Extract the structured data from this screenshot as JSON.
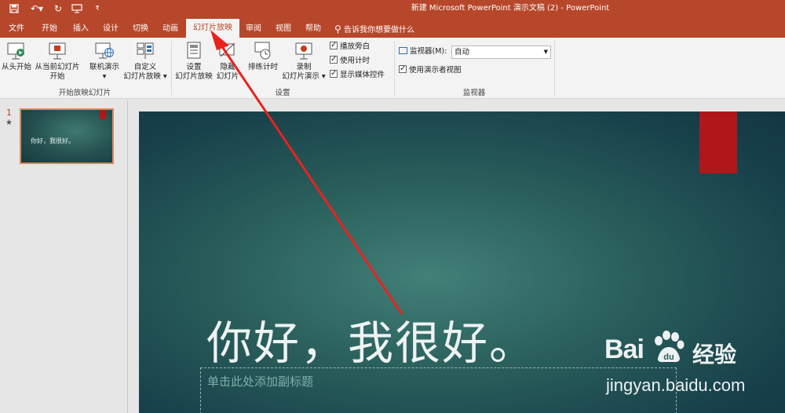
{
  "titlebar": {
    "title": "新建 Microsoft PowerPoint 演示文稿 (2)  -  PowerPoint",
    "qa_icons": [
      "save-icon",
      "undo-icon",
      "redo-icon",
      "present-icon",
      "customize-icon"
    ]
  },
  "tabs": [
    {
      "label": "文件"
    },
    {
      "label": "开始"
    },
    {
      "label": "插入"
    },
    {
      "label": "设计"
    },
    {
      "label": "切换"
    },
    {
      "label": "动画"
    },
    {
      "label": "幻灯片放映",
      "active": true
    },
    {
      "label": "审阅"
    },
    {
      "label": "视图"
    },
    {
      "label": "帮助"
    }
  ],
  "tell_me": "告诉我你想要做什么",
  "ribbon": {
    "start_group": {
      "label": "开始放映幻灯片",
      "from_start": "从头开始",
      "from_current_l1": "从当前幻灯片",
      "from_current_l2": "开始",
      "online_l1": "联机演示",
      "online_l2": "▾",
      "custom_l1": "自定义",
      "custom_l2": "幻灯片放映 ▾"
    },
    "setup_group": {
      "label": "设置",
      "setup_l1": "设置",
      "setup_l2": "幻灯片放映",
      "hide_l1": "隐藏",
      "hide_l2": "幻灯片",
      "rehearse": "排练计时",
      "record_l1": "录制",
      "record_l2": "幻灯片演示 ▾",
      "play_narration": "播放旁白",
      "use_timings": "使用计时",
      "show_media": "显示媒体控件"
    },
    "monitors_group": {
      "label": "监视器",
      "monitor_label": "监视器(M):",
      "monitor_value": "自动",
      "presenter_view": "使用演示者视图"
    }
  },
  "thumbnails": {
    "slide_number": "1",
    "star": "★",
    "thumb_text": "你好，我很好。"
  },
  "slide": {
    "title": "你好，我很好。",
    "subtitle_placeholder": "单击此处添加副标题"
  },
  "watermark": {
    "brand": "Bai",
    "brand_suffix": "经验",
    "url": "jingyan.baidu.com"
  },
  "colors": {
    "accent": "#b7472a",
    "slide_tag": "#b0171a",
    "arrow": "#e8231e"
  }
}
